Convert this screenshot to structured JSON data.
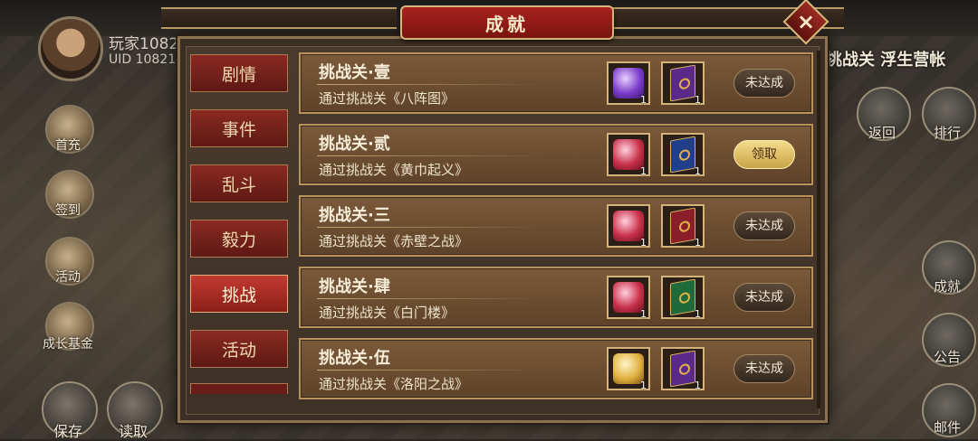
{
  "player": {
    "name": "玩家1082",
    "uid": "UID  10821"
  },
  "left_menu": [
    {
      "label": "首充",
      "icon": "gift-icon"
    },
    {
      "label": "签到",
      "icon": "checkin-icon"
    },
    {
      "label": "活动",
      "icon": "event-icon"
    },
    {
      "label": "成长基金",
      "icon": "fund-icon"
    }
  ],
  "right_menu": [
    {
      "label": "返回",
      "icon": "back-icon"
    },
    {
      "label": "排行",
      "icon": "rank-icon"
    },
    {
      "label": "成就",
      "icon": "achievement-icon"
    },
    {
      "label": "公告",
      "icon": "notice-icon"
    },
    {
      "label": "邮件",
      "icon": "mail-icon"
    }
  ],
  "bottom_menu": [
    {
      "label": "保存",
      "icon": "save-icon"
    },
    {
      "label": "读取",
      "icon": "load-icon"
    }
  ],
  "background_title": "挑战关 浮生营帐",
  "dialog": {
    "title": "成就",
    "close_icon": "×",
    "tabs": [
      {
        "label": "剧情",
        "active": false
      },
      {
        "label": "事件",
        "active": false
      },
      {
        "label": "乱斗",
        "active": false
      },
      {
        "label": "毅力",
        "active": false
      },
      {
        "label": "挑战",
        "active": true
      },
      {
        "label": "活动",
        "active": false
      }
    ],
    "achievements": [
      {
        "title": "挑战关·壹",
        "desc": "通过挑战关《八阵图》",
        "rewards": [
          {
            "icon": "purple-gem-icon",
            "count": "1"
          },
          {
            "icon": "purple-book-icon",
            "count": "1"
          }
        ],
        "status": "未达成",
        "claimable": false
      },
      {
        "title": "挑战关·贰",
        "desc": "通过挑战关《黄巾起义》",
        "rewards": [
          {
            "icon": "red-gem-icon",
            "count": "1"
          },
          {
            "icon": "blue-book-icon",
            "count": "1"
          }
        ],
        "status": "领取",
        "claimable": true
      },
      {
        "title": "挑战关·三",
        "desc": "通过挑战关《赤壁之战》",
        "rewards": [
          {
            "icon": "red-gem-icon",
            "count": "1"
          },
          {
            "icon": "red-book-icon",
            "count": "1"
          }
        ],
        "status": "未达成",
        "claimable": false
      },
      {
        "title": "挑战关·肆",
        "desc": "通过挑战关《白门楼》",
        "rewards": [
          {
            "icon": "red-gem-icon",
            "count": "1"
          },
          {
            "icon": "green-book-icon",
            "count": "1"
          }
        ],
        "status": "未达成",
        "claimable": false
      },
      {
        "title": "挑战关·伍",
        "desc": "通过挑战关《洛阳之战》",
        "rewards": [
          {
            "icon": "gold-gem-icon",
            "count": "1"
          },
          {
            "icon": "purple-book-icon",
            "count": "1"
          }
        ],
        "status": "未达成",
        "claimable": false
      }
    ]
  },
  "colors": {
    "purple_gem": "#7a3cc8",
    "red_gem": "#c8304a",
    "gold_gem": "#e0b040",
    "purple_book": "#5a2a8a",
    "blue_book": "#1f3f8a",
    "red_book": "#8a1f2a",
    "green_book": "#1f6a3a"
  }
}
